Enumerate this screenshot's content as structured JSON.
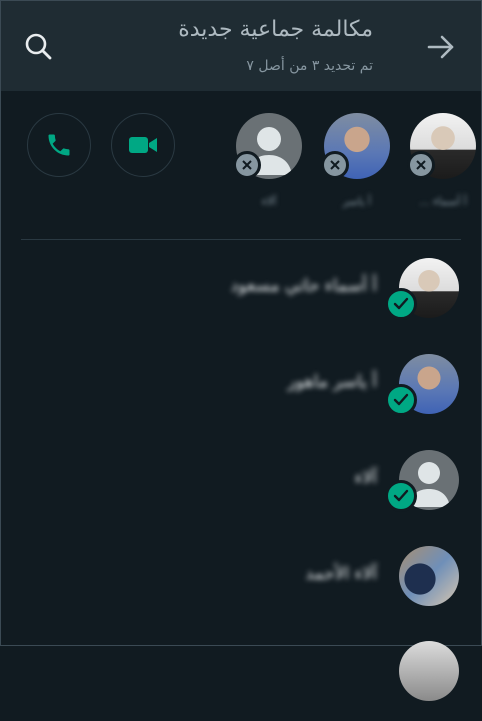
{
  "header": {
    "title": "مكالمة جماعية جديدة",
    "subtitle": "تم تحديد ٣ من أصل ٧"
  },
  "selected": [
    {
      "name": "أ أسماء ..."
    },
    {
      "name": "أ ياسر"
    },
    {
      "name": "آلاء"
    }
  ],
  "contacts": [
    {
      "name": "أ أسماء حاتي مسعود",
      "selected": true
    },
    {
      "name": "أ ياسر ماهور",
      "selected": true
    },
    {
      "name": "آلاء",
      "selected": true
    },
    {
      "name": "آلاء الأحمد",
      "selected": false
    }
  ],
  "colors": {
    "background": "#111b21",
    "header": "#1f2c33",
    "accent": "#00a884",
    "muted": "#8696a0"
  },
  "icons": {
    "search": "search-icon",
    "back": "arrow-forward-icon",
    "voice_call": "phone-icon",
    "video_call": "video-camera-icon",
    "remove": "close-icon",
    "selected": "check-icon"
  }
}
